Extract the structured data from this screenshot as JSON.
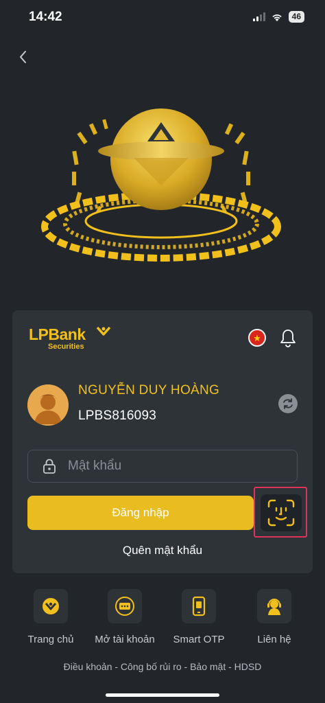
{
  "status_bar": {
    "time": "14:42",
    "battery": "46"
  },
  "brand": {
    "name": "LPBank",
    "sub": "Securities",
    "accent": "#f2c01c"
  },
  "header": {
    "language_flag": "vn-flag",
    "notification_icon": "bell-icon"
  },
  "user": {
    "name": "NGUYỄN DUY HOÀNG",
    "account_id": "LPBS816093"
  },
  "password": {
    "placeholder": "Mật khẩu"
  },
  "actions": {
    "login_label": "Đăng nhập",
    "forgot_label": "Quên mật khẩu",
    "biometric_icon": "face-id-icon"
  },
  "nav": [
    {
      "label": "Trang chủ",
      "icon": "home-icon"
    },
    {
      "label": "Mở tài khoản",
      "icon": "open-account-icon"
    },
    {
      "label": "Smart OTP",
      "icon": "phone-otp-icon"
    },
    {
      "label": "Liên hệ",
      "icon": "support-icon"
    }
  ],
  "footer": {
    "links": "Điều khoản - Công bố rủi ro - Bảo mật - HDSD"
  }
}
